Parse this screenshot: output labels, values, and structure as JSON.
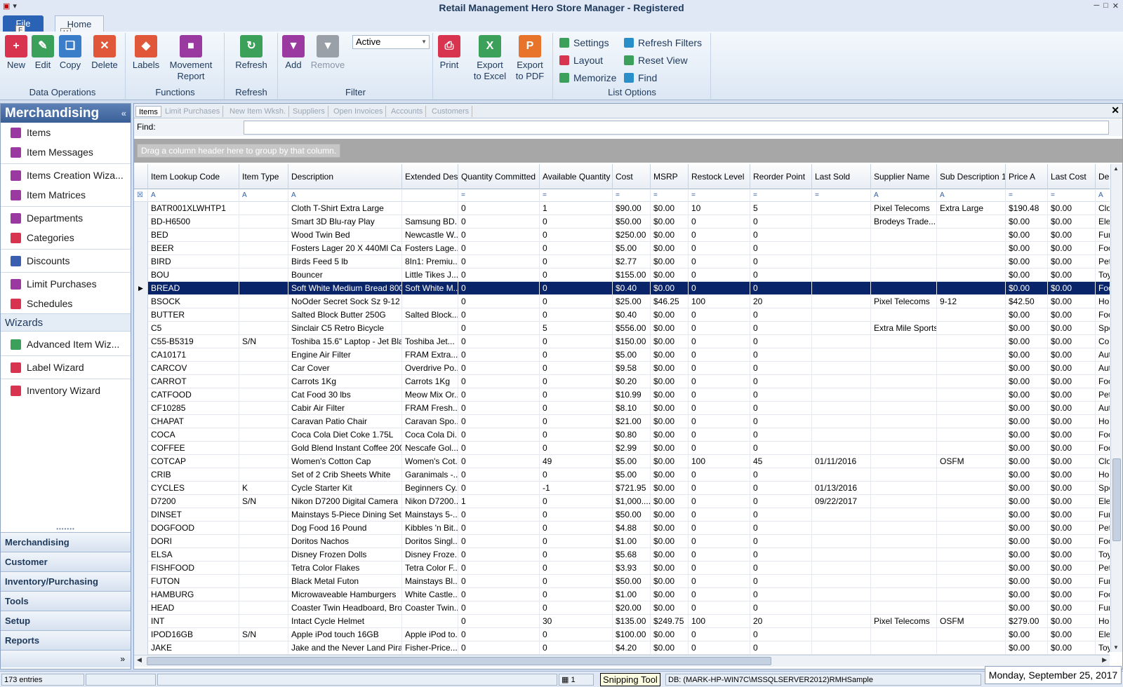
{
  "window": {
    "title": "Retail Management Hero Store Manager - Registered"
  },
  "ribbon_tabs": {
    "file": "File",
    "home": "Home",
    "keytip_file": "F",
    "keytip_home": "H"
  },
  "ribbon": {
    "data_ops": {
      "label": "Data Operations",
      "new": "New",
      "edit": "Edit",
      "copy": "Copy",
      "delete": "Delete"
    },
    "functions": {
      "label": "Functions",
      "labels": "Labels",
      "movement_1": "Movement",
      "movement_2": "Report"
    },
    "refresh": {
      "label": "Refresh",
      "refresh": "Refresh"
    },
    "filter": {
      "label": "Filter",
      "add": "Add",
      "remove": "Remove",
      "select_value": "Active"
    },
    "print": {
      "print": "Print"
    },
    "export": {
      "excel_1": "Export",
      "excel_2": "to Excel",
      "pdf_1": "Export",
      "pdf_2": "to PDF"
    },
    "list_options": {
      "label": "List Options",
      "settings": "Settings",
      "layout": "Layout",
      "memorize": "Memorize",
      "refresh_filters": "Refresh Filters",
      "reset_view": "Reset View",
      "find": "Find"
    }
  },
  "sidebar": {
    "title": "Merchandising",
    "items": {
      "items": "Items",
      "item_messages": "Item Messages",
      "items_creation": "Items Creation Wiza...",
      "item_matrices": "Item Matrices",
      "departments": "Departments",
      "categories": "Categories",
      "discounts": "Discounts",
      "limit_purchases": "Limit Purchases",
      "schedules": "Schedules"
    },
    "wizards_section": "Wizards",
    "wizards": {
      "advanced": "Advanced Item Wiz...",
      "label": "Label Wizard",
      "inventory": "Inventory Wizard"
    },
    "nav": {
      "merchandising": "Merchandising",
      "customer": "Customer",
      "inventory": "Inventory/Purchasing",
      "tools": "Tools",
      "setup": "Setup",
      "reports": "Reports",
      "more": "»"
    }
  },
  "tabs": {
    "items": "Items",
    "limit": "Limit Purchases",
    "new_item": "New Item Wksh.",
    "suppliers": "Suppliers",
    "open_inv": "Open Invoices",
    "accounts": "Accounts",
    "customers": "Customers"
  },
  "find": {
    "label": "Find:"
  },
  "group_hint": "Drag a column header here to group by that column.",
  "columns": [
    "Item Lookup Code",
    "Item Type",
    "Description",
    "Extended Description",
    "Quantity Committed",
    "Available Quantity",
    "Cost",
    "MSRP",
    "Restock Level",
    "Reorder Point",
    "Last Sold",
    "Supplier Name",
    "Sub Description 1",
    "Price A",
    "Last Cost",
    "Dep"
  ],
  "rows": [
    [
      "BATR001XLWHTP1",
      "",
      "Cloth T-Shirt Extra Large",
      "",
      "0",
      "1",
      "$90.00",
      "$0.00",
      "10",
      "5",
      "",
      "Pixel Telecoms",
      "Extra Large",
      "$190.48",
      "$0.00",
      "Clo"
    ],
    [
      "BD-H6500",
      "",
      "Smart 3D Blu-ray Play",
      "Samsung BD...",
      "0",
      "0",
      "$50.00",
      "$0.00",
      "0",
      "0",
      "",
      "Brodeys Trade...",
      "",
      "$0.00",
      "$0.00",
      "Ele"
    ],
    [
      "BED",
      "",
      "Wood Twin Bed",
      "Newcastle W...",
      "0",
      "0",
      "$250.00",
      "$0.00",
      "0",
      "0",
      "",
      "",
      "",
      "$0.00",
      "$0.00",
      "Fur"
    ],
    [
      "BEER",
      "",
      "Fosters Lager 20 X 440Ml Ca...",
      "Fosters Lage...",
      "0",
      "0",
      "$5.00",
      "$0.00",
      "0",
      "0",
      "",
      "",
      "",
      "$0.00",
      "$0.00",
      "Foo"
    ],
    [
      "BIRD",
      "",
      "Birds Feed 5 lb",
      "8In1: Premiu...",
      "0",
      "0",
      "$2.77",
      "$0.00",
      "0",
      "0",
      "",
      "",
      "",
      "$0.00",
      "$0.00",
      "Pet"
    ],
    [
      "BOU",
      "",
      "Bouncer",
      "Little Tikes J...",
      "0",
      "0",
      "$155.00",
      "$0.00",
      "0",
      "0",
      "",
      "",
      "",
      "$0.00",
      "$0.00",
      "Toy"
    ],
    [
      "BREAD",
      "",
      "Soft White Medium Bread 800...",
      "Soft White M...",
      "0",
      "0",
      "$0.40",
      "$0.00",
      "0",
      "0",
      "",
      "",
      "",
      "$0.00",
      "$0.00",
      "Foo"
    ],
    [
      "BSOCK",
      "",
      "NoOder Secret Sock Sz 9-12",
      "",
      "0",
      "0",
      "$25.00",
      "$46.25",
      "100",
      "20",
      "",
      "Pixel Telecoms",
      "9-12",
      "$42.50",
      "$0.00",
      "Hol"
    ],
    [
      "BUTTER",
      "",
      "Salted Block Butter 250G",
      "Salted Block...",
      "0",
      "0",
      "$0.40",
      "$0.00",
      "0",
      "0",
      "",
      "",
      "",
      "$0.00",
      "$0.00",
      "Foo"
    ],
    [
      "C5",
      "",
      "Sinclair C5 Retro Bicycle",
      "",
      "0",
      "5",
      "$556.00",
      "$0.00",
      "0",
      "0",
      "",
      "Extra Mile Sports",
      "",
      "$0.00",
      "$0.00",
      "Spo"
    ],
    [
      "C55-B5319",
      "S/N",
      "Toshiba 15.6\" Laptop - Jet Bla",
      "Toshiba Jet...",
      "0",
      "0",
      "$150.00",
      "$0.00",
      "0",
      "0",
      "",
      "",
      "",
      "$0.00",
      "$0.00",
      "Con"
    ],
    [
      "CA10171",
      "",
      "Engine Air Filter",
      "FRAM Extra...",
      "0",
      "0",
      "$5.00",
      "$0.00",
      "0",
      "0",
      "",
      "",
      "",
      "$0.00",
      "$0.00",
      "Aut"
    ],
    [
      "CARCOV",
      "",
      "Car Cover",
      "Overdrive Po...",
      "0",
      "0",
      "$9.58",
      "$0.00",
      "0",
      "0",
      "",
      "",
      "",
      "$0.00",
      "$0.00",
      "Aut"
    ],
    [
      "CARROT",
      "",
      "Carrots 1Kg",
      "Carrots 1Kg",
      "0",
      "0",
      "$0.20",
      "$0.00",
      "0",
      "0",
      "",
      "",
      "",
      "$0.00",
      "$0.00",
      "Foo"
    ],
    [
      "CATFOOD",
      "",
      "Cat Food 30 lbs",
      "Meow Mix Or...",
      "0",
      "0",
      "$10.99",
      "$0.00",
      "0",
      "0",
      "",
      "",
      "",
      "$0.00",
      "$0.00",
      "Pet"
    ],
    [
      "CF10285",
      "",
      "Cabir Air Filter",
      "FRAM Fresh...",
      "0",
      "0",
      "$8.10",
      "$0.00",
      "0",
      "0",
      "",
      "",
      "",
      "$0.00",
      "$0.00",
      "Aut"
    ],
    [
      "CHAPAT",
      "",
      "Caravan Patio Chair",
      "Caravan Spo...",
      "0",
      "0",
      "$21.00",
      "$0.00",
      "0",
      "0",
      "",
      "",
      "",
      "$0.00",
      "$0.00",
      "Hor"
    ],
    [
      "COCA",
      "",
      "Coca Cola Diet Coke 1.75L",
      "Coca Cola Di...",
      "0",
      "0",
      "$0.80",
      "$0.00",
      "0",
      "0",
      "",
      "",
      "",
      "$0.00",
      "$0.00",
      "Foo"
    ],
    [
      "COFFEE",
      "",
      "Gold Blend Instant Coffee 200...",
      "Nescafe Gol...",
      "0",
      "0",
      "$2.99",
      "$0.00",
      "0",
      "0",
      "",
      "",
      "",
      "$0.00",
      "$0.00",
      "Foo"
    ],
    [
      "COTCAP",
      "",
      "Women's Cotton Cap",
      "Women's Cot...",
      "0",
      "49",
      "$5.00",
      "$0.00",
      "100",
      "45",
      "01/11/2016",
      "",
      "OSFM",
      "$0.00",
      "$0.00",
      "Clo"
    ],
    [
      "CRIB",
      "",
      "Set of 2 Crib Sheets White",
      "Garanimals -...",
      "0",
      "0",
      "$5.00",
      "$0.00",
      "0",
      "0",
      "",
      "",
      "",
      "$0.00",
      "$0.00",
      "Hor"
    ],
    [
      "CYCLES",
      "K",
      "Cycle Starter Kit",
      "Beginners Cy...",
      "0",
      "-1",
      "$721.95",
      "$0.00",
      "0",
      "0",
      "01/13/2016",
      "",
      "",
      "$0.00",
      "$0.00",
      "Spo"
    ],
    [
      "D7200",
      "S/N",
      "Nikon D7200 Digital Camera",
      "Nikon D7200...",
      "1",
      "0",
      "$1,000....",
      "$0.00",
      "0",
      "0",
      "09/22/2017",
      "",
      "",
      "$0.00",
      "$0.00",
      "Ele"
    ],
    [
      "DINSET",
      "",
      "Mainstays 5-Piece Dining Set",
      "Mainstays 5-...",
      "0",
      "0",
      "$50.00",
      "$0.00",
      "0",
      "0",
      "",
      "",
      "",
      "$0.00",
      "$0.00",
      "Fur"
    ],
    [
      "DOGFOOD",
      "",
      "Dog Food 16 Pound",
      "Kibbles 'n Bit...",
      "0",
      "0",
      "$4.88",
      "$0.00",
      "0",
      "0",
      "",
      "",
      "",
      "$0.00",
      "$0.00",
      "Pet"
    ],
    [
      "DORI",
      "",
      "Doritos Nachos",
      "Doritos Singl...",
      "0",
      "0",
      "$1.00",
      "$0.00",
      "0",
      "0",
      "",
      "",
      "",
      "$0.00",
      "$0.00",
      "Foo"
    ],
    [
      "ELSA",
      "",
      "Disney Frozen Dolls",
      "Disney Froze...",
      "0",
      "0",
      "$5.68",
      "$0.00",
      "0",
      "0",
      "",
      "",
      "",
      "$0.00",
      "$0.00",
      "Toy"
    ],
    [
      "FISHFOOD",
      "",
      "Tetra Color Flakes",
      "Tetra Color F...",
      "0",
      "0",
      "$3.93",
      "$0.00",
      "0",
      "0",
      "",
      "",
      "",
      "$0.00",
      "$0.00",
      "Pet"
    ],
    [
      "FUTON",
      "",
      "Black Metal Futon",
      "Mainstays Bl...",
      "0",
      "0",
      "$50.00",
      "$0.00",
      "0",
      "0",
      "",
      "",
      "",
      "$0.00",
      "$0.00",
      "Fur"
    ],
    [
      "HAMBURG",
      "",
      "Microwaveable Hamburgers",
      "White Castle...",
      "0",
      "0",
      "$1.00",
      "$0.00",
      "0",
      "0",
      "",
      "",
      "",
      "$0.00",
      "$0.00",
      "Foo"
    ],
    [
      "HEAD",
      "",
      "Coaster Twin Headboard, Bro...",
      "Coaster Twin...",
      "0",
      "0",
      "$20.00",
      "$0.00",
      "0",
      "0",
      "",
      "",
      "",
      "$0.00",
      "$0.00",
      "Fur"
    ],
    [
      "INT",
      "",
      "Intact Cycle Helmet",
      "",
      "0",
      "30",
      "$135.00",
      "$249.75",
      "100",
      "20",
      "",
      "Pixel Telecoms",
      "OSFM",
      "$279.00",
      "$0.00",
      "Hol"
    ],
    [
      "IPOD16GB",
      "S/N",
      "Apple iPod touch 16GB",
      "Apple iPod to...",
      "0",
      "0",
      "$100.00",
      "$0.00",
      "0",
      "0",
      "",
      "",
      "",
      "$0.00",
      "$0.00",
      "Ele"
    ],
    [
      "JAKE",
      "",
      "Jake and the Never Land Pira...",
      "Fisher-Price...",
      "0",
      "0",
      "$4.20",
      "$0.00",
      "0",
      "0",
      "",
      "",
      "",
      "$0.00",
      "$0.00",
      "Toy"
    ]
  ],
  "selected_row": 6,
  "status": {
    "entries": "173 entries",
    "page": "1",
    "db": "DB: (MARK-HP-WIN7C\\MSSQLSERVER2012)RMHSample",
    "snip": "Snipping Tool",
    "date": "Monday, September 25, 2017"
  },
  "colors": {
    "selected_row": "#0a246a",
    "header_blue": "#3a5f97"
  }
}
